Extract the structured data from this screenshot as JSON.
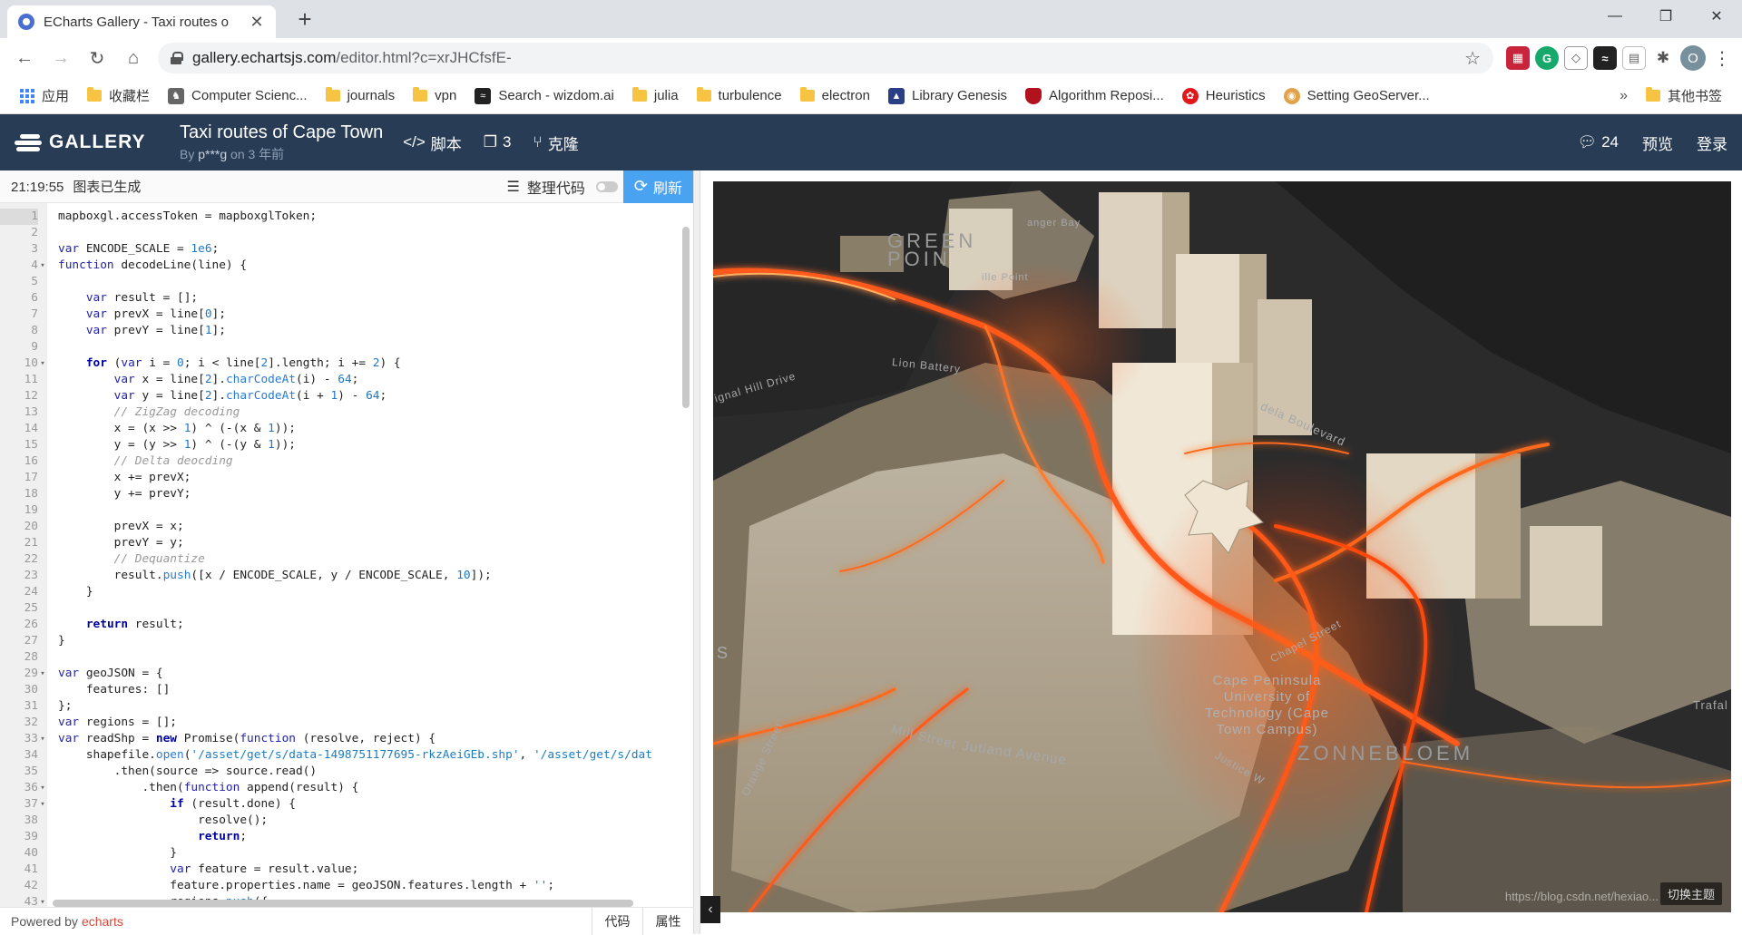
{
  "browser": {
    "tab_title": "ECharts Gallery - Taxi routes o",
    "url_host": "gallery.echartsjs.com",
    "url_path": "/editor.html?c=xrJHCfsfE-",
    "bookmarks": [
      {
        "label": "应用",
        "icon": "apps-icon"
      },
      {
        "label": "收藏栏",
        "icon": "folder-icon"
      },
      {
        "label": "Computer Scienc...",
        "icon": "cs-icon"
      },
      {
        "label": "journals",
        "icon": "folder-icon"
      },
      {
        "label": "vpn",
        "icon": "folder-icon"
      },
      {
        "label": "Search - wizdom.ai",
        "icon": "wizdom-icon"
      },
      {
        "label": "julia",
        "icon": "folder-icon"
      },
      {
        "label": "turbulence",
        "icon": "folder-icon"
      },
      {
        "label": "electron",
        "icon": "folder-icon"
      },
      {
        "label": "Library Genesis",
        "icon": "libgen-icon"
      },
      {
        "label": "Algorithm Reposi...",
        "icon": "shield-icon"
      },
      {
        "label": "Heuristics",
        "icon": "heuristics-icon"
      },
      {
        "label": "Setting GeoServer...",
        "icon": "geoserver-icon"
      }
    ],
    "bookmarks_more": "»",
    "other_bookmarks": "其他书签",
    "avatar_letter": "O"
  },
  "header": {
    "logo_text": "GALLERY",
    "title": "Taxi routes of Cape Town",
    "by_prefix": "By",
    "author": "p***g",
    "time": "on 3 年前",
    "script_label": "脚本",
    "forks_count": "3",
    "clone_label": "克隆",
    "comments_count": "24",
    "preview_label": "预览",
    "login_label": "登录"
  },
  "editor": {
    "time": "21:19:55",
    "status": "图表已生成",
    "format_label": "整理代码",
    "refresh_label": "刷新",
    "powered_by": "Powered by",
    "powered_link": "echarts",
    "tab_code": "代码",
    "tab_props": "属性"
  },
  "map": {
    "labels": {
      "green_point_1": "GREEN",
      "green_point_2": "POIN",
      "granger_bay": "anger Bay",
      "mouille_point": "ille Point",
      "lion_battery": "Lion Battery",
      "signal_hill": "ignal Hill Drive",
      "mandela_blvd": "dela Boulevard",
      "chapel_street": "Chapel Street",
      "cput_1": "Cape Peninsula",
      "cput_2": "University of",
      "cput_3": "Technology (Cape",
      "cput_4": "Town Campus)",
      "zonnebloem": "ZONNEBLOEM",
      "jutland": "Jutland Avenue",
      "mill_street": "Mill Street",
      "orange_street": "Orange Street",
      "trafalgar": "Trafal",
      "justice": "Justice W",
      "side_s": "S"
    },
    "theme_button": "切换主题",
    "watermark": "https://blog.csdn.net/hexiao..."
  }
}
